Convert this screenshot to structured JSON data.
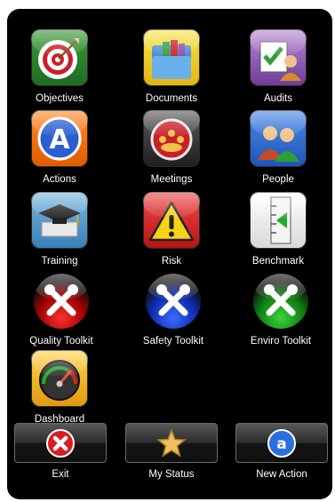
{
  "tiles": [
    {
      "label": "Objectives",
      "icon": "target-icon"
    },
    {
      "label": "Documents",
      "icon": "folder-icon"
    },
    {
      "label": "Audits",
      "icon": "audit-checklist-icon"
    },
    {
      "label": "Actions",
      "icon": "actions-a-icon"
    },
    {
      "label": "Meetings",
      "icon": "meeting-group-icon"
    },
    {
      "label": "People",
      "icon": "people-icon"
    },
    {
      "label": "Training",
      "icon": "graduation-cap-icon"
    },
    {
      "label": "Risk",
      "icon": "warning-icon"
    },
    {
      "label": "Benchmark",
      "icon": "benchmark-arrow-icon"
    },
    {
      "label": "Quality Toolkit",
      "icon": "tools-red-icon"
    },
    {
      "label": "Safety Toolkit",
      "icon": "tools-blue-icon"
    },
    {
      "label": "Enviro Toolkit",
      "icon": "tools-green-icon"
    },
    {
      "label": "Dashboard",
      "icon": "gauge-icon"
    }
  ],
  "buttons": [
    {
      "label": "Exit",
      "icon": "exit-x-icon"
    },
    {
      "label": "My Status",
      "icon": "star-icon"
    },
    {
      "label": "New Action",
      "icon": "new-action-a-icon"
    }
  ],
  "colors": {
    "background": "#000000",
    "quality": "#d81e1e",
    "safety": "#1d3fd6",
    "enviro": "#1fae2a"
  }
}
